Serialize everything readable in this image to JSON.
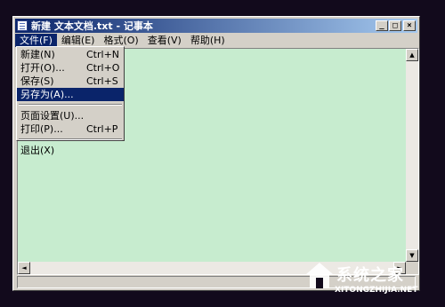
{
  "window": {
    "title": "新建 文本文档.txt - 记事本",
    "buttons": {
      "minimize": "_",
      "maximize": "□",
      "close": "×"
    }
  },
  "menubar": {
    "items": [
      {
        "label": "文件(F)"
      },
      {
        "label": "编辑(E)"
      },
      {
        "label": "格式(O)"
      },
      {
        "label": "查看(V)"
      },
      {
        "label": "帮助(H)"
      }
    ]
  },
  "file_menu": {
    "items": [
      {
        "label": "新建(N)",
        "shortcut": "Ctrl+N"
      },
      {
        "label": "打开(O)...",
        "shortcut": "Ctrl+O"
      },
      {
        "label": "保存(S)",
        "shortcut": "Ctrl+S"
      },
      {
        "label": "另存为(A)...",
        "shortcut": ""
      },
      {
        "label": "页面设置(U)...",
        "shortcut": ""
      },
      {
        "label": "打印(P)...",
        "shortcut": "Ctrl+P"
      },
      {
        "label": "退出(X)",
        "shortcut": ""
      }
    ]
  },
  "scrollbar": {
    "up": "▲",
    "down": "▼",
    "left": "◄",
    "right": "►"
  },
  "watermark": {
    "name": "系统之家",
    "url": "XITONGZHIJIA.NET"
  },
  "colors": {
    "titlebar": "#0a246a",
    "editor_bg": "#c7eccf",
    "selection": "#0a246a"
  }
}
